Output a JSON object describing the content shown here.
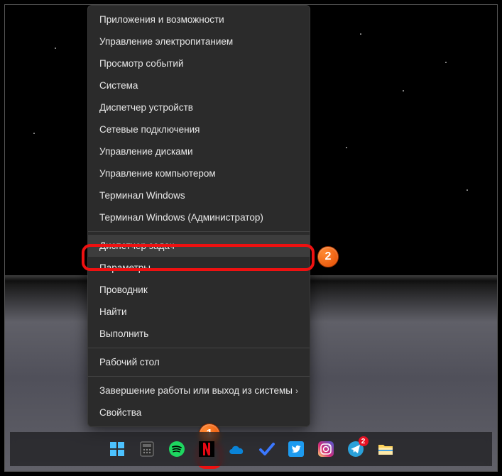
{
  "menu": {
    "items": [
      {
        "label": "Приложения и возможности"
      },
      {
        "label": "Управление электропитанием"
      },
      {
        "label": "Просмотр событий"
      },
      {
        "label": "Система"
      },
      {
        "label": "Диспетчер устройств"
      },
      {
        "label": "Сетевые подключения"
      },
      {
        "label": "Управление дисками"
      },
      {
        "label": "Управление компьютером"
      },
      {
        "label": "Терминал Windows"
      },
      {
        "label": "Терминал Windows (Администратор)"
      },
      {
        "label": "Диспетчер задач"
      },
      {
        "label": "Параметры"
      },
      {
        "label": "Проводник"
      },
      {
        "label": "Найти"
      },
      {
        "label": "Выполнить"
      },
      {
        "label": "Рабочий стол"
      },
      {
        "label": "Завершение работы или выход из системы"
      },
      {
        "label": "Свойства"
      }
    ],
    "hovered_index": 10,
    "separators_after": [
      9,
      14,
      15
    ]
  },
  "annotations": {
    "badge1": "1",
    "badge2": "2"
  },
  "taskbar": {
    "telegram_badge": "2"
  }
}
